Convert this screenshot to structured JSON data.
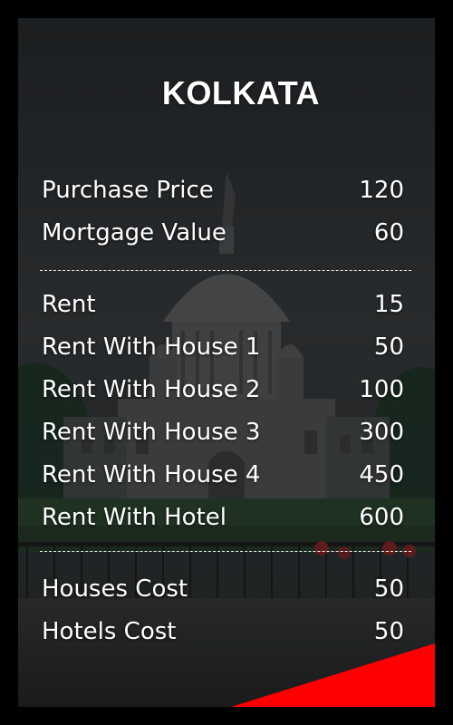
{
  "card": {
    "title": "KOLKATA",
    "accent_color": "#ff0000",
    "price_rows": [
      {
        "label": "Purchase Price",
        "value": "120"
      },
      {
        "label": "Mortgage Value",
        "value": "60"
      }
    ],
    "rent_rows": [
      {
        "label": "Rent",
        "value": "15"
      },
      {
        "label": "Rent With House 1",
        "value": "50"
      },
      {
        "label": "Rent With House 2",
        "value": "100"
      },
      {
        "label": "Rent With House 3",
        "value": "300"
      },
      {
        "label": "Rent With House 4",
        "value": "450"
      },
      {
        "label": "Rent With Hotel",
        "value": "600"
      }
    ],
    "cost_rows": [
      {
        "label": "Houses Cost",
        "value": "50"
      },
      {
        "label": "Hotels Cost",
        "value": "50"
      }
    ]
  }
}
